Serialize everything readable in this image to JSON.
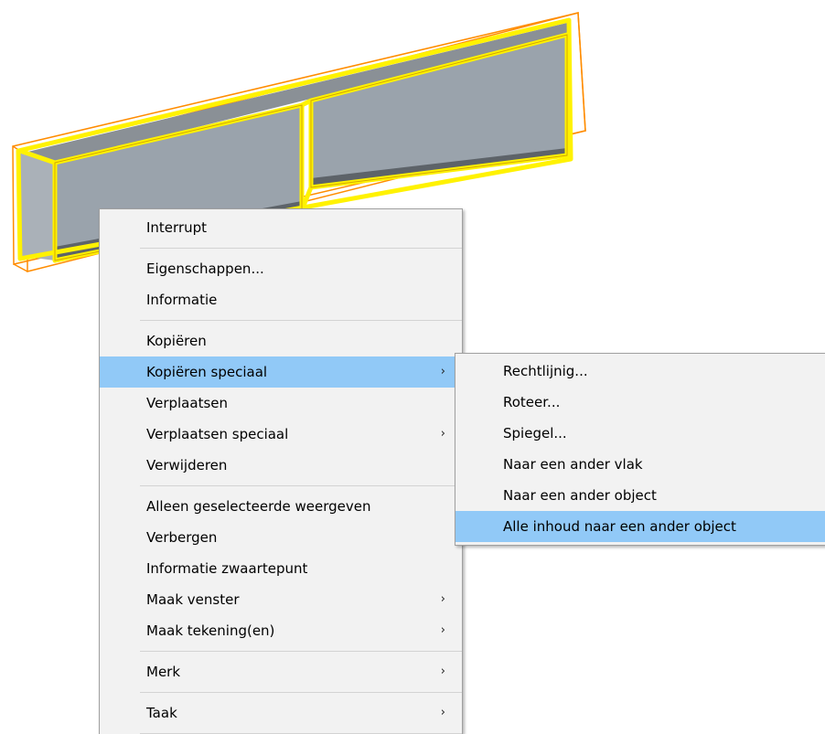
{
  "colors": {
    "selection_highlight": "#fff200",
    "bounding_box": "#ff8c00",
    "beam_face_dark": "#7e848a",
    "beam_face_light": "#9aa3ac",
    "menu_background": "#f2f2f2",
    "menu_hover": "#91c9f7"
  },
  "context_menu": {
    "groups": [
      {
        "items": [
          {
            "label": "Interrupt",
            "submenu": false
          }
        ]
      },
      {
        "items": [
          {
            "label": "Eigenschappen...",
            "submenu": false
          },
          {
            "label": "Informatie",
            "submenu": false
          }
        ]
      },
      {
        "items": [
          {
            "label": "Kopiëren",
            "submenu": false
          },
          {
            "label": "Kopiëren speciaal",
            "submenu": true,
            "highlighted": true
          },
          {
            "label": "Verplaatsen",
            "submenu": false
          },
          {
            "label": "Verplaatsen speciaal",
            "submenu": true
          },
          {
            "label": "Verwijderen",
            "submenu": false
          }
        ]
      },
      {
        "items": [
          {
            "label": "Alleen geselecteerde weergeven",
            "submenu": false
          },
          {
            "label": "Verbergen",
            "submenu": false
          },
          {
            "label": "Informatie zwaartepunt",
            "submenu": false
          },
          {
            "label": "Maak venster",
            "submenu": true
          },
          {
            "label": "Maak tekening(en)",
            "submenu": true
          }
        ]
      },
      {
        "items": [
          {
            "label": "Merk",
            "submenu": true
          }
        ]
      },
      {
        "items": [
          {
            "label": "Taak",
            "submenu": true
          }
        ]
      }
    ]
  },
  "submenu": {
    "parent": "Kopiëren speciaal",
    "items": [
      {
        "label": "Rechtlijnig..."
      },
      {
        "label": "Roteer..."
      },
      {
        "label": "Spiegel..."
      },
      {
        "label": "Naar een ander vlak"
      },
      {
        "label": "Naar een ander object"
      },
      {
        "label": "Alle inhoud naar een ander object",
        "highlighted": true
      }
    ]
  },
  "arrow_glyph": "›"
}
